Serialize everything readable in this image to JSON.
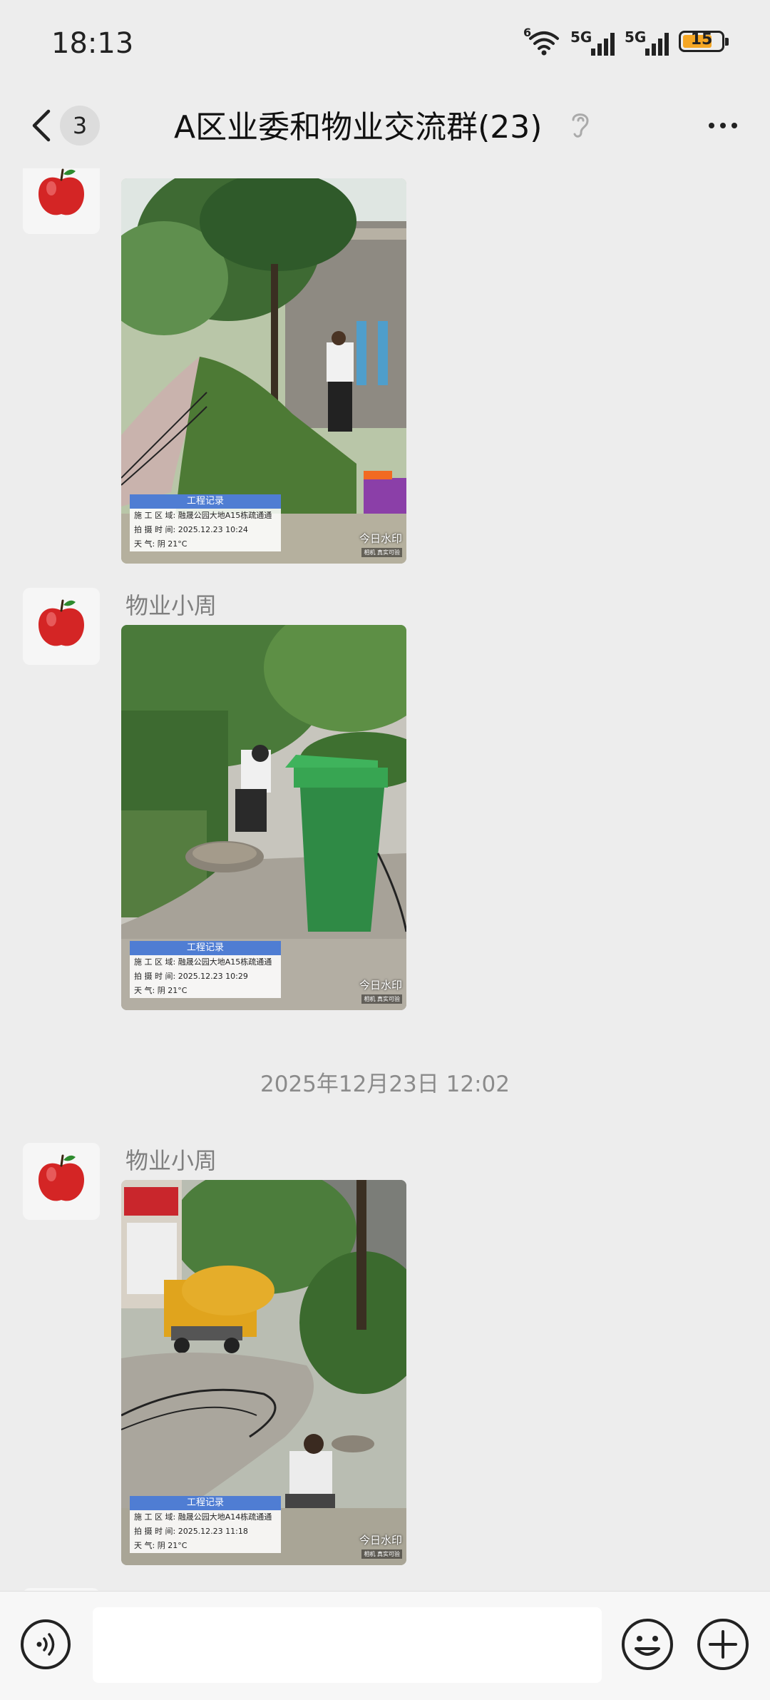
{
  "status_bar": {
    "time": "18:13",
    "wifi_label": "6",
    "signal_1": "5G",
    "signal_2": "5G",
    "battery": "15"
  },
  "header": {
    "back_badge": "3",
    "title": "A区业委和物业交流群(23)"
  },
  "messages": [
    {
      "sender": "",
      "photo": {
        "stamp_title": "工程记录",
        "rows": [
          "施 工 区 域: 融晟公园大地A15栋疏通通",
          "拍 摄 时 间: 2025.12.23 10:24",
          "天       气: 阴 21°C"
        ],
        "watermark": "今日水印",
        "watermark_sub": "相机 真实可验"
      }
    },
    {
      "sender": "物业小周",
      "photo": {
        "stamp_title": "工程记录",
        "rows": [
          "施 工 区 域: 融晟公园大地A15栋疏通通",
          "拍 摄 时 间: 2025.12.23 10:29",
          "天       气: 阴 21°C"
        ],
        "watermark": "今日水印",
        "watermark_sub": "相机 真实可验"
      }
    },
    {
      "sender": "物业小周",
      "photo": {
        "stamp_title": "工程记录",
        "rows": [
          "施 工 区 域: 融晟公园大地A14栋疏通通",
          "拍 摄 时 间: 2025.12.23 11:18",
          "天       气: 阴 21°C"
        ],
        "watermark": "今日水印",
        "watermark_sub": "相机 真实可验"
      }
    }
  ],
  "timestamp": "2025年12月23日 12:02",
  "icons": {
    "avatar": "apple-icon",
    "back": "chevron-left-icon",
    "ear": "ear-icon",
    "more": "more-dots-icon",
    "voice": "voice-icon",
    "emoji": "emoji-icon",
    "plus": "plus-icon"
  },
  "colors": {
    "background": "#ededed",
    "stamp_header": "#4f7dd3",
    "battery_fill": "#f5a623"
  }
}
